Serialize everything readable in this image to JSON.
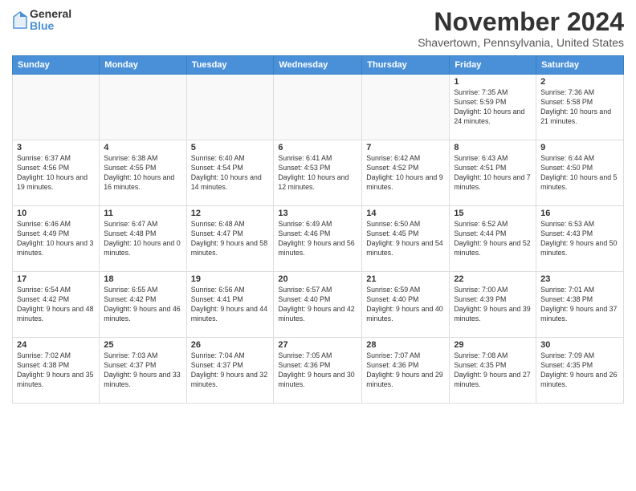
{
  "logo": {
    "general": "General",
    "blue": "Blue"
  },
  "title": "November 2024",
  "subtitle": "Shavertown, Pennsylvania, United States",
  "days_of_week": [
    "Sunday",
    "Monday",
    "Tuesday",
    "Wednesday",
    "Thursday",
    "Friday",
    "Saturday"
  ],
  "weeks": [
    [
      {
        "day": "",
        "info": ""
      },
      {
        "day": "",
        "info": ""
      },
      {
        "day": "",
        "info": ""
      },
      {
        "day": "",
        "info": ""
      },
      {
        "day": "",
        "info": ""
      },
      {
        "day": "1",
        "info": "Sunrise: 7:35 AM\nSunset: 5:59 PM\nDaylight: 10 hours and 24 minutes."
      },
      {
        "day": "2",
        "info": "Sunrise: 7:36 AM\nSunset: 5:58 PM\nDaylight: 10 hours and 21 minutes."
      }
    ],
    [
      {
        "day": "3",
        "info": "Sunrise: 6:37 AM\nSunset: 4:56 PM\nDaylight: 10 hours and 19 minutes."
      },
      {
        "day": "4",
        "info": "Sunrise: 6:38 AM\nSunset: 4:55 PM\nDaylight: 10 hours and 16 minutes."
      },
      {
        "day": "5",
        "info": "Sunrise: 6:40 AM\nSunset: 4:54 PM\nDaylight: 10 hours and 14 minutes."
      },
      {
        "day": "6",
        "info": "Sunrise: 6:41 AM\nSunset: 4:53 PM\nDaylight: 10 hours and 12 minutes."
      },
      {
        "day": "7",
        "info": "Sunrise: 6:42 AM\nSunset: 4:52 PM\nDaylight: 10 hours and 9 minutes."
      },
      {
        "day": "8",
        "info": "Sunrise: 6:43 AM\nSunset: 4:51 PM\nDaylight: 10 hours and 7 minutes."
      },
      {
        "day": "9",
        "info": "Sunrise: 6:44 AM\nSunset: 4:50 PM\nDaylight: 10 hours and 5 minutes."
      }
    ],
    [
      {
        "day": "10",
        "info": "Sunrise: 6:46 AM\nSunset: 4:49 PM\nDaylight: 10 hours and 3 minutes."
      },
      {
        "day": "11",
        "info": "Sunrise: 6:47 AM\nSunset: 4:48 PM\nDaylight: 10 hours and 0 minutes."
      },
      {
        "day": "12",
        "info": "Sunrise: 6:48 AM\nSunset: 4:47 PM\nDaylight: 9 hours and 58 minutes."
      },
      {
        "day": "13",
        "info": "Sunrise: 6:49 AM\nSunset: 4:46 PM\nDaylight: 9 hours and 56 minutes."
      },
      {
        "day": "14",
        "info": "Sunrise: 6:50 AM\nSunset: 4:45 PM\nDaylight: 9 hours and 54 minutes."
      },
      {
        "day": "15",
        "info": "Sunrise: 6:52 AM\nSunset: 4:44 PM\nDaylight: 9 hours and 52 minutes."
      },
      {
        "day": "16",
        "info": "Sunrise: 6:53 AM\nSunset: 4:43 PM\nDaylight: 9 hours and 50 minutes."
      }
    ],
    [
      {
        "day": "17",
        "info": "Sunrise: 6:54 AM\nSunset: 4:42 PM\nDaylight: 9 hours and 48 minutes."
      },
      {
        "day": "18",
        "info": "Sunrise: 6:55 AM\nSunset: 4:42 PM\nDaylight: 9 hours and 46 minutes."
      },
      {
        "day": "19",
        "info": "Sunrise: 6:56 AM\nSunset: 4:41 PM\nDaylight: 9 hours and 44 minutes."
      },
      {
        "day": "20",
        "info": "Sunrise: 6:57 AM\nSunset: 4:40 PM\nDaylight: 9 hours and 42 minutes."
      },
      {
        "day": "21",
        "info": "Sunrise: 6:59 AM\nSunset: 4:40 PM\nDaylight: 9 hours and 40 minutes."
      },
      {
        "day": "22",
        "info": "Sunrise: 7:00 AM\nSunset: 4:39 PM\nDaylight: 9 hours and 39 minutes."
      },
      {
        "day": "23",
        "info": "Sunrise: 7:01 AM\nSunset: 4:38 PM\nDaylight: 9 hours and 37 minutes."
      }
    ],
    [
      {
        "day": "24",
        "info": "Sunrise: 7:02 AM\nSunset: 4:38 PM\nDaylight: 9 hours and 35 minutes."
      },
      {
        "day": "25",
        "info": "Sunrise: 7:03 AM\nSunset: 4:37 PM\nDaylight: 9 hours and 33 minutes."
      },
      {
        "day": "26",
        "info": "Sunrise: 7:04 AM\nSunset: 4:37 PM\nDaylight: 9 hours and 32 minutes."
      },
      {
        "day": "27",
        "info": "Sunrise: 7:05 AM\nSunset: 4:36 PM\nDaylight: 9 hours and 30 minutes."
      },
      {
        "day": "28",
        "info": "Sunrise: 7:07 AM\nSunset: 4:36 PM\nDaylight: 9 hours and 29 minutes."
      },
      {
        "day": "29",
        "info": "Sunrise: 7:08 AM\nSunset: 4:35 PM\nDaylight: 9 hours and 27 minutes."
      },
      {
        "day": "30",
        "info": "Sunrise: 7:09 AM\nSunset: 4:35 PM\nDaylight: 9 hours and 26 minutes."
      }
    ]
  ]
}
